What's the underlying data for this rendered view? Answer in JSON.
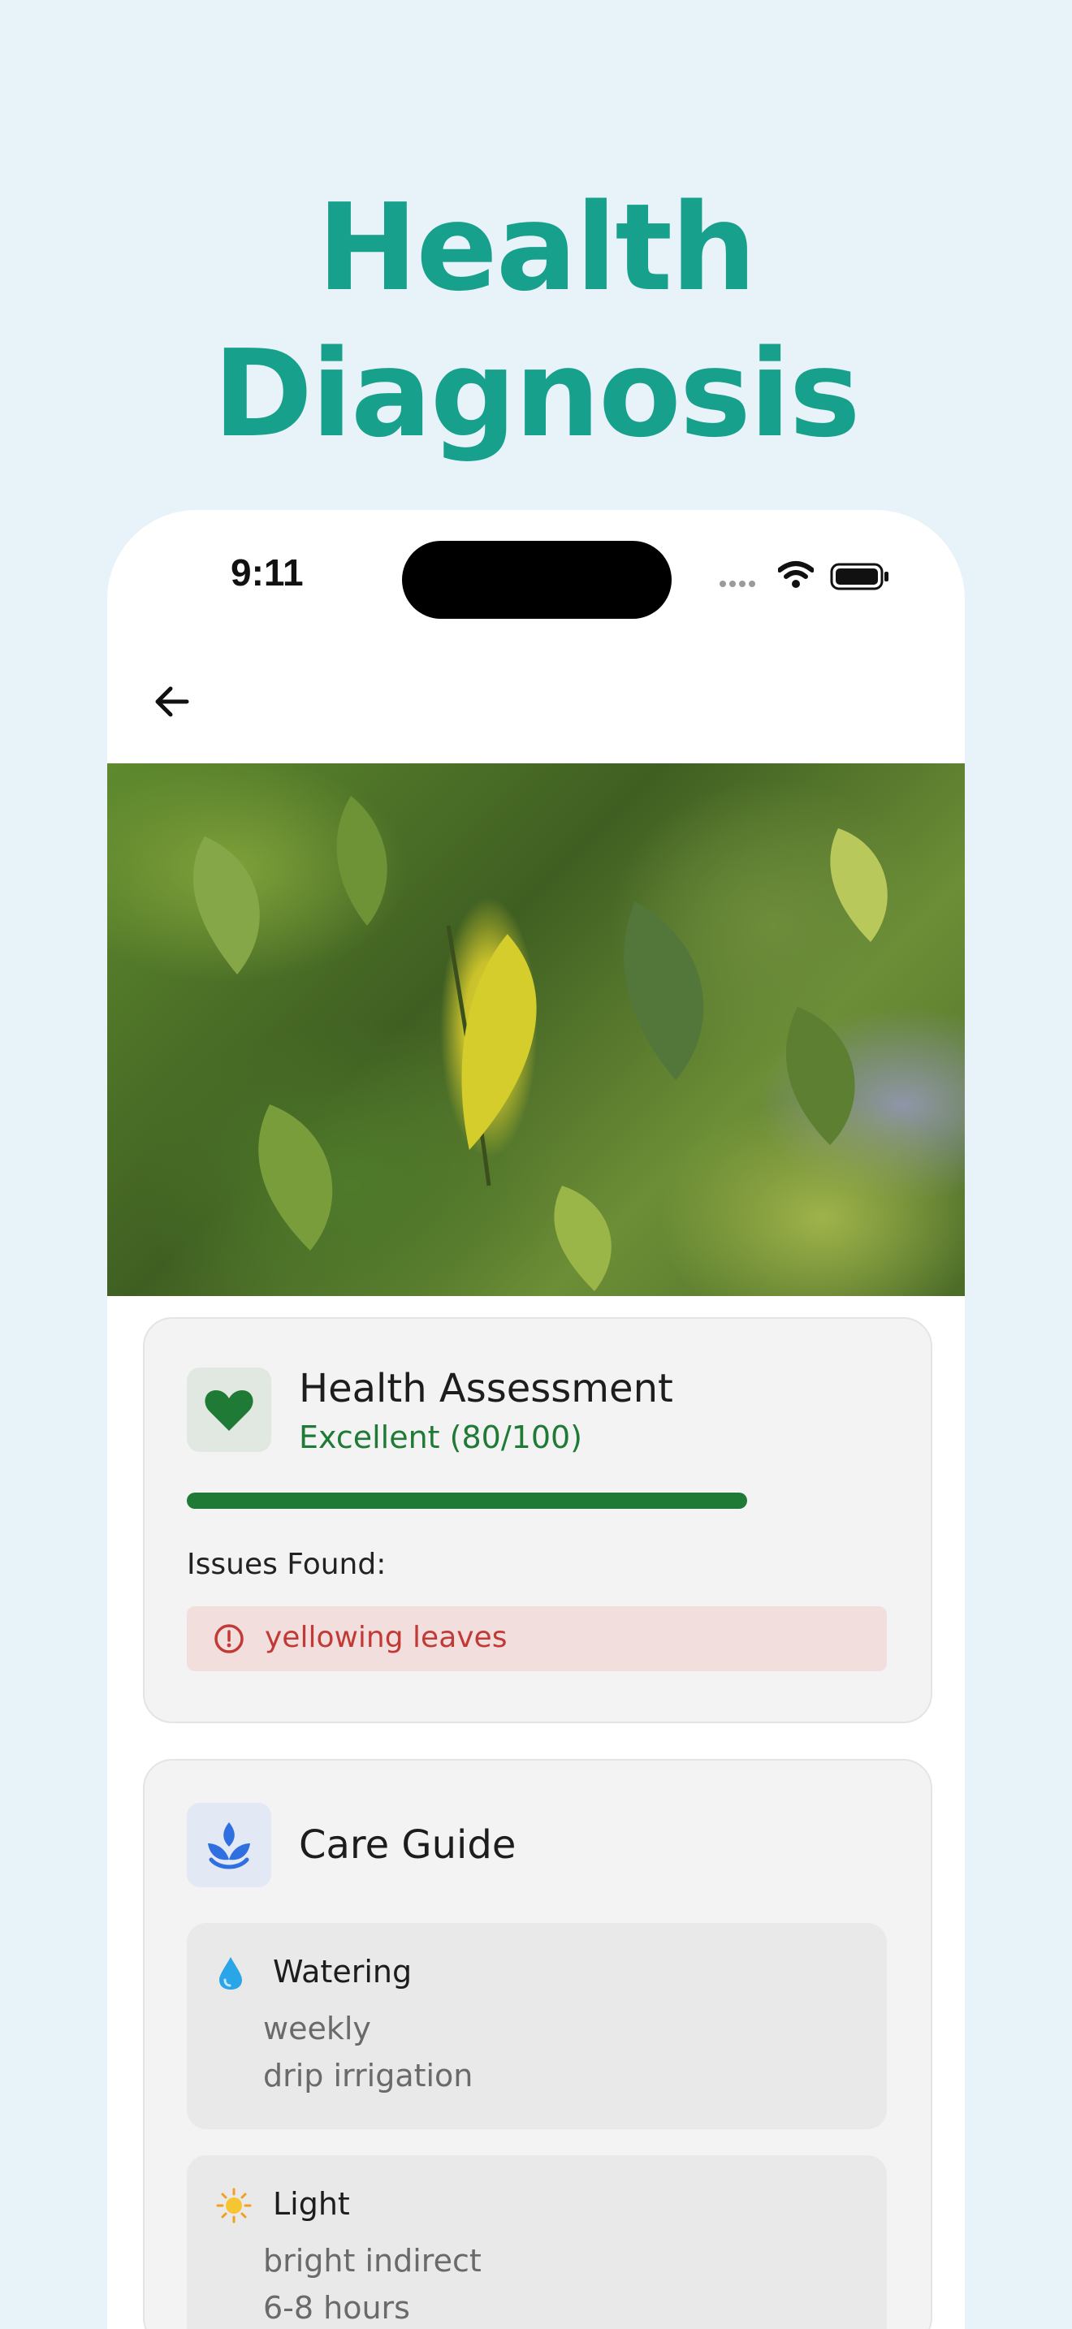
{
  "headline": "Health Diagnosis",
  "status_bar": {
    "time": "9:11"
  },
  "health": {
    "title": "Health Assessment",
    "score_text": "Excellent (80/100)",
    "score_fraction": 0.8,
    "issues_label": "Issues Found:",
    "issues": [
      "yellowing leaves"
    ]
  },
  "care": {
    "title": "Care Guide",
    "items": [
      {
        "title": "Watering",
        "icon": "water-drop-icon",
        "lines": [
          "weekly",
          "drip irrigation"
        ]
      },
      {
        "title": "Light",
        "icon": "sun-icon",
        "lines": [
          "bright indirect",
          "6-8 hours"
        ]
      }
    ]
  },
  "colors": {
    "accent": "#17a08b",
    "good": "#1e7a35",
    "issue": "#c23a36",
    "care_icon": "#2f6fe0"
  }
}
